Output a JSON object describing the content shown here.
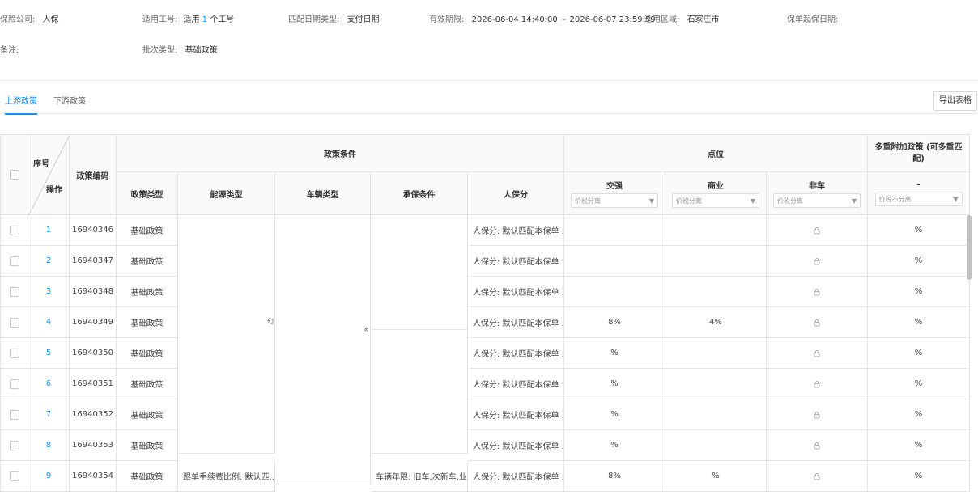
{
  "info": {
    "company_label": "保险公司:",
    "company_value": "人保",
    "workno_label": "适用工号:",
    "workno_prefix": "适用",
    "workno_count": "1",
    "workno_suffix": "个工号",
    "match_date_label": "匹配日期类型:",
    "match_date_value": "支付日期",
    "valid_label": "有效期限:",
    "valid_value": "2026-06-04 14:40:00 ~ 2026-06-07 23:59:59",
    "region_label": "适用区域:",
    "region_value": "石家庄市",
    "start_date_label": "保单起保日期:",
    "remark_label": "备注:",
    "batch_label": "批次类型:",
    "batch_value": "基础政策"
  },
  "tabs": [
    "上游政策",
    "下游政策"
  ],
  "export_label": "导出表格",
  "table": {
    "header": {
      "index": "序号",
      "action": "操作",
      "code": "政策编码",
      "conditions": "政策条件",
      "points": "点位",
      "multi": "多重附加政策 (可多重匹配)",
      "policy_type": "政策类型",
      "energy_type": "能源类型",
      "vehicle_type": "车辆类型",
      "insure_cond": "承保条件",
      "score": "人保分",
      "jiaoqiang": "交强",
      "shangye": "商业",
      "feiche": "非车",
      "multi_sub": "-",
      "select_tax_split": "价税分离",
      "select_tax_nosplit": "价税不分离"
    },
    "rows": [
      {
        "no": "1",
        "code": "16940346",
        "type": "基础政策",
        "score": "人保分: 默认匹配本保单 ...",
        "jq": "",
        "sy": "",
        "pct": "%"
      },
      {
        "no": "2",
        "code": "16940347",
        "type": "基础政策",
        "score": "人保分: 默认匹配本保单 ...",
        "jq": "",
        "sy": "",
        "pct": "%"
      },
      {
        "no": "3",
        "code": "16940348",
        "type": "基础政策",
        "score": "人保分: 默认匹配本保单 ...",
        "jq": "",
        "sy": "",
        "pct": "%"
      },
      {
        "no": "4",
        "code": "16940349",
        "type": "基础政策",
        "score": "人保分: 默认匹配本保单 ...",
        "jq": "8%",
        "sy": "4%",
        "pct": "%"
      },
      {
        "no": "5",
        "code": "16940350",
        "type": "基础政策",
        "score": "人保分: 默认匹配本保单 ...",
        "jq": "%",
        "sy": "",
        "pct": "%"
      },
      {
        "no": "6",
        "code": "16940351",
        "type": "基础政策",
        "score": "人保分: 默认匹配本保单 ...",
        "jq": "%",
        "sy": "",
        "pct": "%"
      },
      {
        "no": "7",
        "code": "16940352",
        "type": "基础政策",
        "score": "人保分: 默认匹配本保单 ...",
        "jq": "%",
        "sy": "",
        "pct": "%"
      },
      {
        "no": "8",
        "code": "16940353",
        "type": "基础政策",
        "score": "人保分: 默认匹配本保单 ...",
        "jq": "%",
        "sy": "",
        "pct": "%"
      },
      {
        "no": "9",
        "code": "16940354",
        "type": "基础政策",
        "score": "人保分: 默认匹配本保单 ...",
        "jq": "8%",
        "sy": "%",
        "pct": "%"
      }
    ],
    "row9_energy": "跟单手续费比例: 默认匹...",
    "row9_insure": "车辆年限: 旧车,次新车,业..."
  }
}
